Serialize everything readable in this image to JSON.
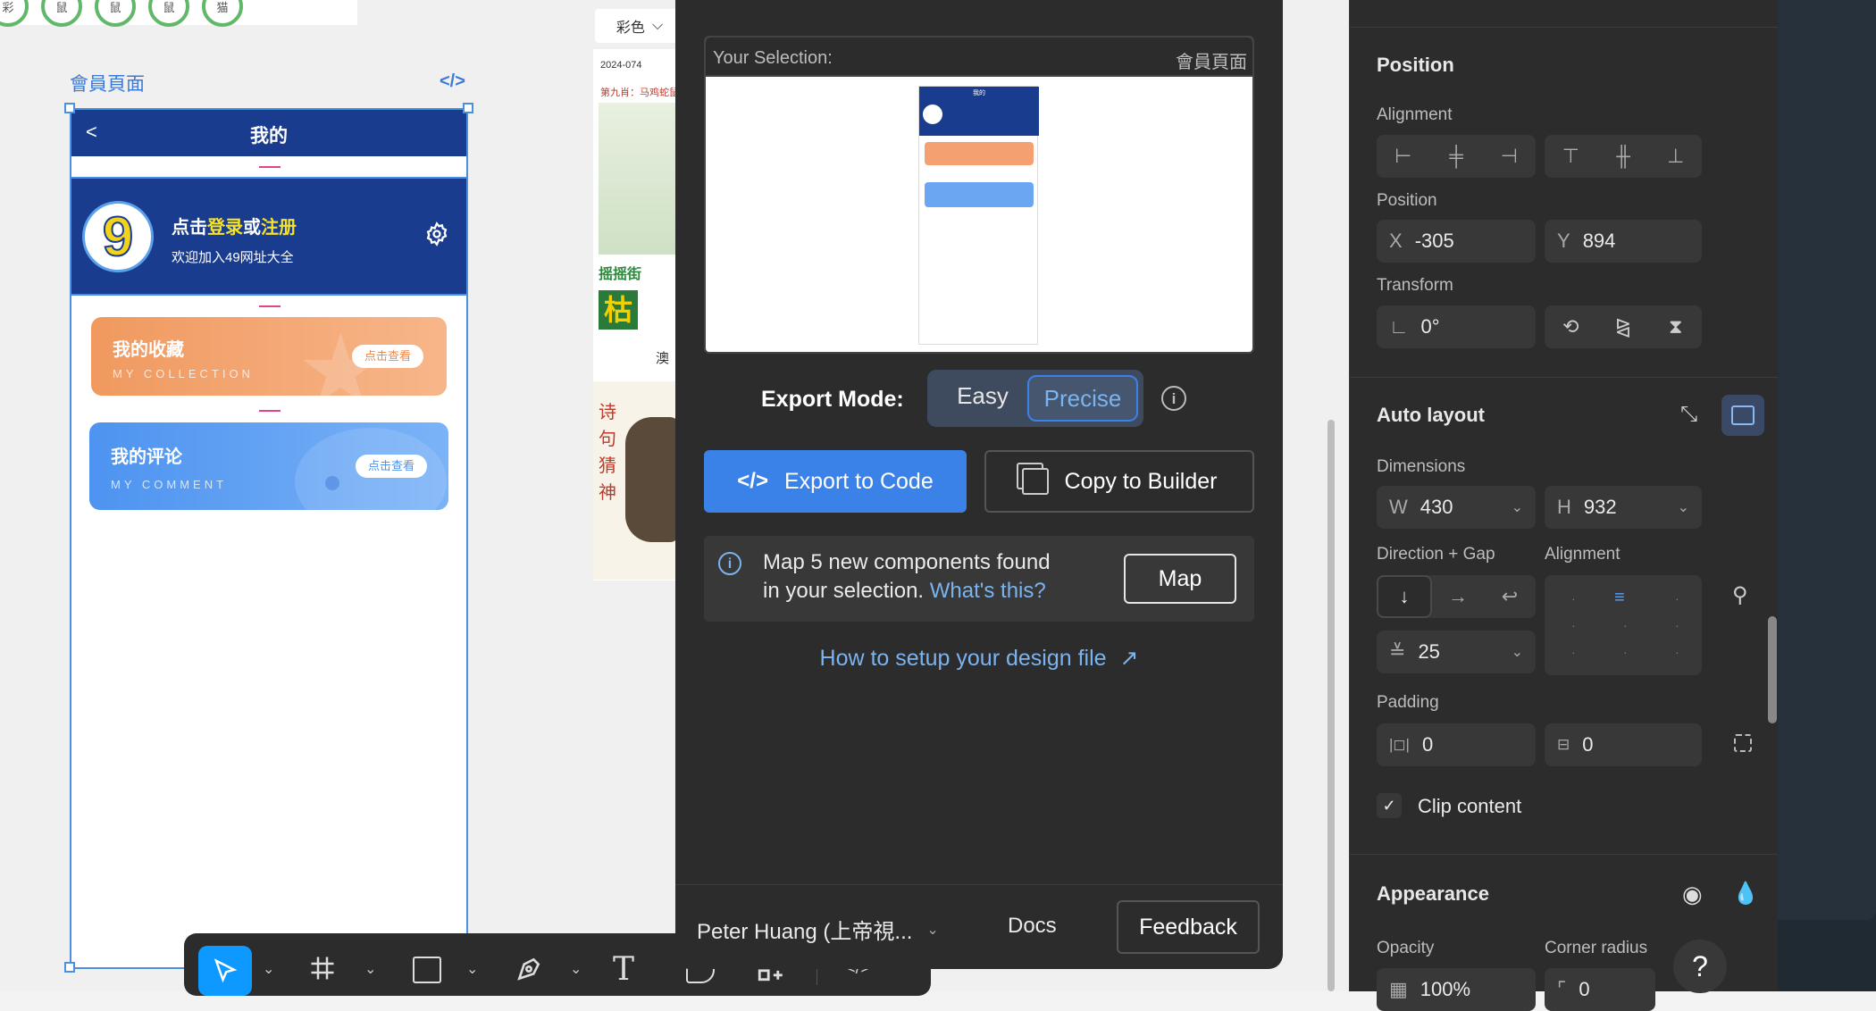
{
  "canvas": {
    "frame_title": "會員頁面",
    "code_icon": "</>",
    "caise_label": "彩色",
    "partial_circles": [
      "彩",
      "鼠",
      "鼠",
      "鼠",
      "猫"
    ],
    "newspaper_texts": [
      "2024-074",
      "第九肖：马鸡蛇鼠猴羊",
      "摇摇街",
      "枯",
      "澳",
      "诗",
      "句",
      "猜",
      "神"
    ]
  },
  "phone": {
    "back": "<",
    "title": "我的",
    "avatar_number": "9",
    "login_prefix": "点击",
    "login_link1": "登录",
    "login_mid": "或",
    "login_link2": "注册",
    "welcome": "欢迎加入49网址大全",
    "card1_title": "我的收藏",
    "card1_sub": "MY COLLECTION",
    "card1_btn": "点击查看",
    "card2_title": "我的评论",
    "card2_sub": "MY COMMENT",
    "card2_btn": "点击查看"
  },
  "plugin": {
    "your_selection": "Your Selection:",
    "selection_name": "會員頁面",
    "thumb_title": "我的",
    "export_mode_label": "Export Mode:",
    "mode_easy": "Easy",
    "mode_precise": "Precise",
    "export_btn": "Export to Code",
    "copy_btn": "Copy to Builder",
    "map_msg_1": "Map 5 new components found",
    "map_msg_2": "in your selection.",
    "whats_this": "What's this?",
    "map_btn": "Map",
    "setup_link": "How to setup your design file",
    "user": "Peter Huang (上帝視...",
    "docs": "Docs",
    "feedback": "Feedback"
  },
  "props": {
    "position_title": "Position",
    "alignment_label": "Alignment",
    "position_label": "Position",
    "x_label": "X",
    "x_value": "-305",
    "y_label": "Y",
    "y_value": "894",
    "transform_label": "Transform",
    "rotation_value": "0°",
    "autolayout_title": "Auto layout",
    "dimensions_label": "Dimensions",
    "w_label": "W",
    "w_value": "430",
    "h_label": "H",
    "h_value": "932",
    "direction_label": "Direction + Gap",
    "alignment2_label": "Alignment",
    "gap_value": "25",
    "padding_label": "Padding",
    "pad_h_value": "0",
    "pad_v_value": "0",
    "clip_label": "Clip content",
    "appearance_title": "Appearance",
    "opacity_label": "Opacity",
    "corner_label": "Corner radius",
    "opacity_value": "100%",
    "corner_value": "0",
    "help": "?"
  },
  "colors": {
    "accent_blue": "#3b82e8",
    "phone_navy": "#1a3c8f",
    "orange": "#f2a374",
    "blue_card": "#5b9df2",
    "dark_bg": "#2c2c2c",
    "link_blue": "#7ab4f0"
  }
}
